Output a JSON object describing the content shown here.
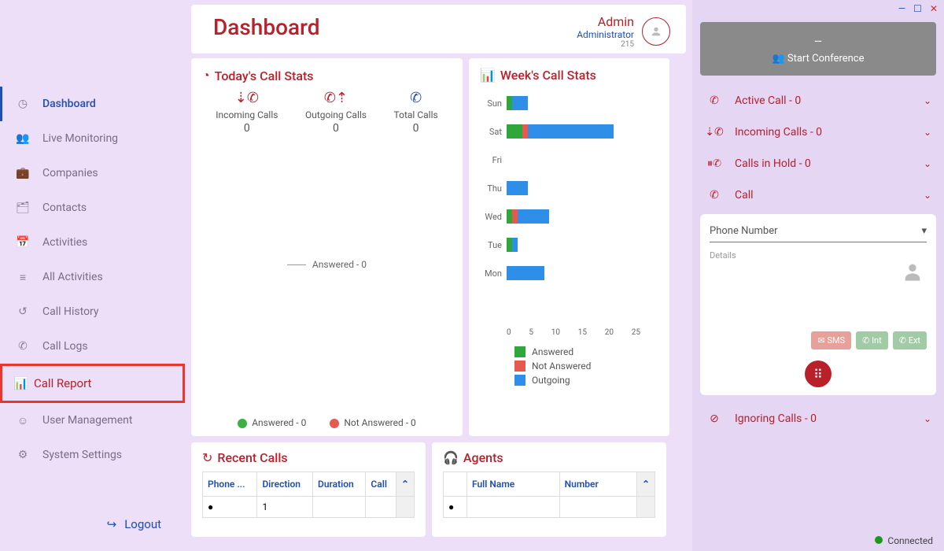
{
  "header": {
    "title": "Dashboard",
    "user_name": "Admin",
    "user_role": "Administrator",
    "user_num": "215"
  },
  "sidebar": {
    "items": [
      {
        "label": "Dashboard"
      },
      {
        "label": "Live Monitoring"
      },
      {
        "label": "Companies"
      },
      {
        "label": "Contacts"
      },
      {
        "label": "Activities"
      },
      {
        "label": "All Activities"
      },
      {
        "label": "Call History"
      },
      {
        "label": "Call Logs"
      },
      {
        "label": "Call Report"
      },
      {
        "label": "User Management"
      },
      {
        "label": "System Settings"
      }
    ],
    "logout": "Logout"
  },
  "today": {
    "title": "Today's Call Stats",
    "incoming_label": "Incoming Calls",
    "incoming_val": "0",
    "outgoing_label": "Outgoing Calls",
    "outgoing_val": "0",
    "total_label": "Total Calls",
    "total_val": "0",
    "answered_line": "Answered - 0",
    "answered_status": "Answered - 0",
    "notanswered_status": "Not Answered - 0"
  },
  "week": {
    "title": "Week's Call Stats",
    "legend": {
      "answered": "Answered",
      "notanswered": "Not Answered",
      "outgoing": "Outgoing"
    }
  },
  "chart_data": {
    "type": "bar",
    "orientation": "horizontal",
    "stacked": true,
    "xlabel": "",
    "ylabel": "",
    "xlim": [
      0,
      25
    ],
    "x_ticks": [
      "0",
      "5",
      "10",
      "15",
      "20",
      "25"
    ],
    "categories": [
      "Sun",
      "Sat",
      "Fri",
      "Thu",
      "Wed",
      "Tue",
      "Mon"
    ],
    "series": [
      {
        "name": "Answered",
        "color": "#2fa73b",
        "values": [
          1,
          3,
          0,
          0,
          1,
          1,
          0
        ]
      },
      {
        "name": "Not Answered",
        "color": "#e7584f",
        "values": [
          0,
          1,
          0,
          0,
          1,
          0,
          0
        ]
      },
      {
        "name": "Outgoing",
        "color": "#2f8fe8",
        "values": [
          3,
          16,
          0,
          4,
          6,
          1,
          7
        ]
      }
    ]
  },
  "recent": {
    "title": "Recent Calls",
    "cols": [
      "Phone ...",
      "Direction",
      "Duration",
      "Call"
    ],
    "row1_val": "1"
  },
  "agents": {
    "title": "Agents",
    "cols": [
      "",
      "Full Name",
      "Number"
    ]
  },
  "right": {
    "conf_dash": "--",
    "conf_start": "Start Conference",
    "active": "Active Call - 0",
    "incoming": "Incoming Calls - 0",
    "hold": "Calls in Hold - 0",
    "call": "Call",
    "phone_placeholder": "Phone Number",
    "details": "Details",
    "sms": "SMS",
    "int": "Int",
    "ext": "Ext",
    "ignoring": "Ignoring Calls - 0",
    "connected": "Connected"
  },
  "colors": {
    "brand": "#b8202a",
    "link": "#1e4fb3"
  }
}
